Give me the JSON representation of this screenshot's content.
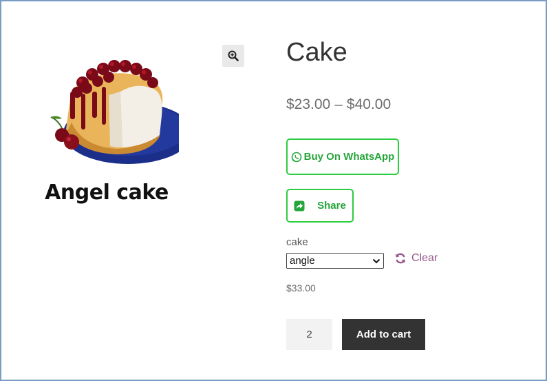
{
  "product": {
    "image_caption": "Angel cake",
    "title": "Cake",
    "price_min": "$23.00",
    "price_separator": "–",
    "price_max": "$40.00"
  },
  "actions": {
    "whatsapp_label": "Buy On WhatsApp",
    "share_label": "Share"
  },
  "variation": {
    "attribute_label": "cake",
    "selected_option": "angle",
    "clear_label": "Clear",
    "variation_price": "$33.00"
  },
  "cart": {
    "quantity": "2",
    "add_to_cart_label": "Add to cart"
  },
  "colors": {
    "accent_green": "#2ecc40",
    "link_purple": "#96588a",
    "button_dark": "#333333"
  },
  "icons": [
    "zoom-in-icon",
    "whatsapp-icon",
    "share-icon",
    "refresh-icon",
    "chevron-down-icon"
  ]
}
